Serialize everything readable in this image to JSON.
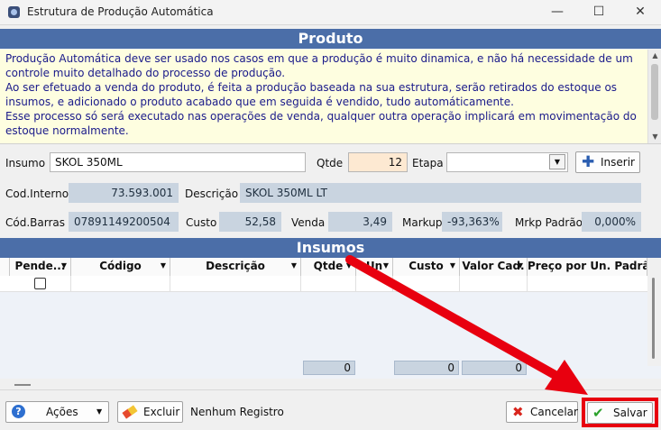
{
  "window": {
    "title": "Estrutura de Produção Automática",
    "minimize": "—",
    "maximize": "☐",
    "close": "✕"
  },
  "produto_header": "Produto",
  "info_lines": [
    "Produção Automática deve ser usado nos casos em que a produção é muito dinamica, e não há necessidade de um controle muito detalhado do processo de produção.",
    "Ao ser efetuado a venda do produto, é feita a produção baseada na sua estrutura, serão retirados do estoque os insumos, e adicionado o produto acabado que em seguida é vendido, tudo automáticamente.",
    "Esse processo só será executado nas operações de venda, qualquer outra operação implicará em movimentação do estoque normalmente."
  ],
  "form": {
    "insumo_label": "Insumo",
    "insumo_value": "SKOL 350ML",
    "qtde_label": "Qtde",
    "qtde_value": "12",
    "etapa_label": "Etapa",
    "etapa_value": "",
    "inserir_label": "Inserir",
    "codinterno_label": "Cod.Interno",
    "codinterno_value": "73.593.001",
    "descricao_label": "Descrição",
    "descricao_value": "SKOL 350ML LT",
    "codbarras_label": "Cód.Barras",
    "codbarras_value": "07891149200504",
    "custo_label": "Custo",
    "custo_value": "52,58",
    "venda_label": "Venda",
    "venda_value": "3,49",
    "markup_label": "Markup",
    "markup_value": "-93,363%",
    "mrkp_label": "Mrkp Padrão",
    "mrkp_value": "0,000%"
  },
  "insumos_header": "Insumos",
  "grid": {
    "columns": [
      "Pende...",
      "Código",
      "Descrição",
      "Qtde",
      "Un",
      "Custo",
      "Valor Cad.",
      "Preço por Un. Padrã"
    ],
    "totals": {
      "qtde": "0",
      "custo": "0",
      "valor_cad": "0"
    }
  },
  "footer": {
    "acoes_label": "Ações",
    "excluir_label": "Excluir",
    "status": "Nenhum Registro",
    "cancelar_label": "Cancelar",
    "salvar_label": "Salvar"
  },
  "colors": {
    "header_blue": "#4b6ea8",
    "info_bg": "#fefee0",
    "readonly_bg": "#c9d4e0",
    "highlight_red": "#e8000f"
  }
}
